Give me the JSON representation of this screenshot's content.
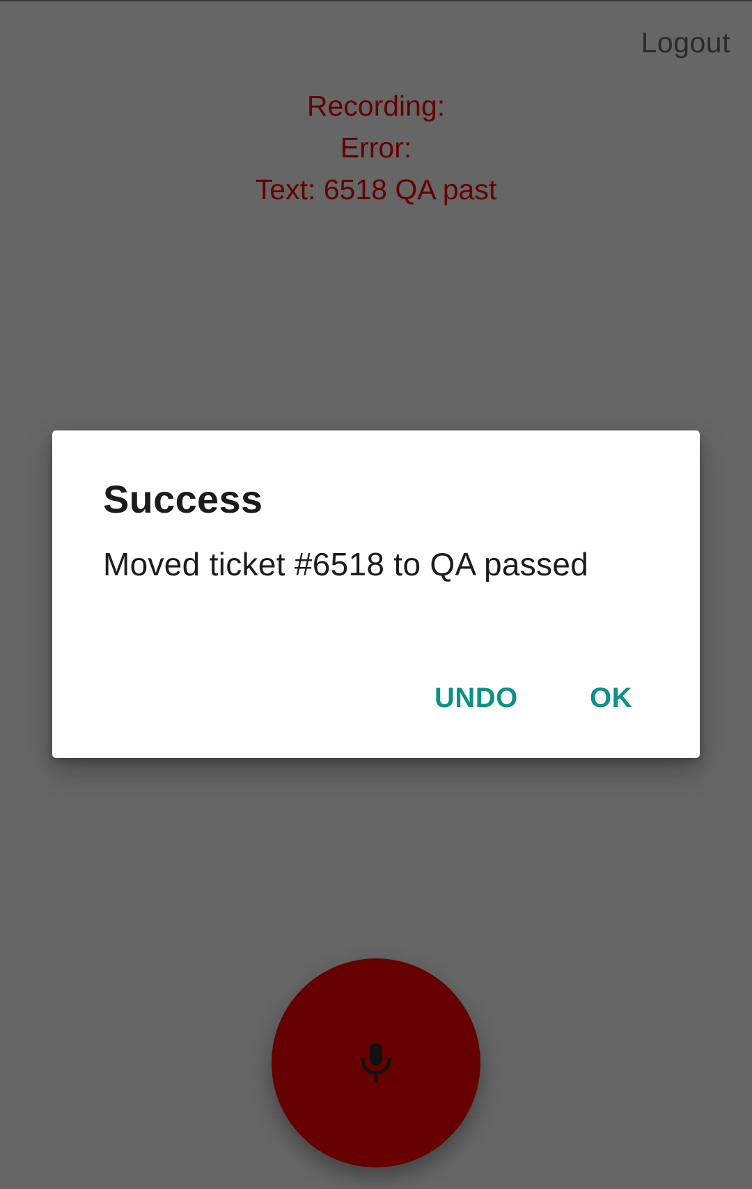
{
  "header": {
    "logout_label": "Logout"
  },
  "status": {
    "recording": "Recording:",
    "error": "Error:",
    "text": "Text: 6518 QA past"
  },
  "dialog": {
    "title": "Success",
    "message": "Moved ticket #6518 to QA passed",
    "undo_label": "UNDO",
    "ok_label": "OK"
  },
  "fab": {
    "icon": "microphone-icon"
  },
  "colors": {
    "scrim": "#666666",
    "status_text": "#660000",
    "fab": "#660000",
    "dialog_button": "#0c9186",
    "dialog_text": "#1c1c1c"
  }
}
